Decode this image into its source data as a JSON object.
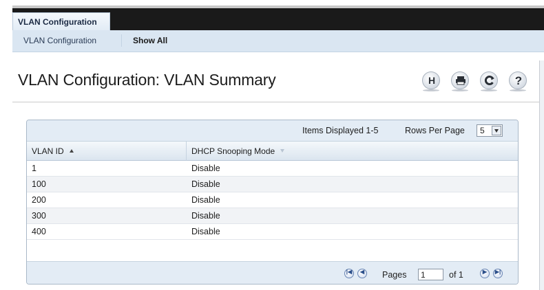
{
  "app_tab": {
    "label": "VLAN Configuration"
  },
  "subnav": {
    "items": [
      {
        "label": "VLAN Configuration"
      },
      {
        "label": "Show All"
      }
    ]
  },
  "page": {
    "title": "VLAN Configuration: VLAN Summary"
  },
  "toolbar": {
    "buttons": [
      {
        "icon": "save-icon"
      },
      {
        "icon": "print-icon"
      },
      {
        "icon": "refresh-icon"
      },
      {
        "icon": "help-icon"
      }
    ]
  },
  "table": {
    "items_displayed": "Items Displayed 1-5",
    "rows_per_page_label": "Rows Per Page",
    "rows_per_page_value": "5",
    "columns": [
      "VLAN ID",
      "DHCP Snooping Mode"
    ],
    "rows": [
      {
        "vlan_id": "1",
        "mode": "Disable"
      },
      {
        "vlan_id": "100",
        "mode": "Disable"
      },
      {
        "vlan_id": "200",
        "mode": "Disable"
      },
      {
        "vlan_id": "300",
        "mode": "Disable"
      },
      {
        "vlan_id": "400",
        "mode": "Disable"
      }
    ]
  },
  "pagination": {
    "pages_label": "Pages",
    "current_page": "1",
    "of_label": "of 1"
  },
  "colors": {
    "accent": "#dae6f2",
    "topbar": "#1a1a1a",
    "panel": "#e3ecf5"
  }
}
